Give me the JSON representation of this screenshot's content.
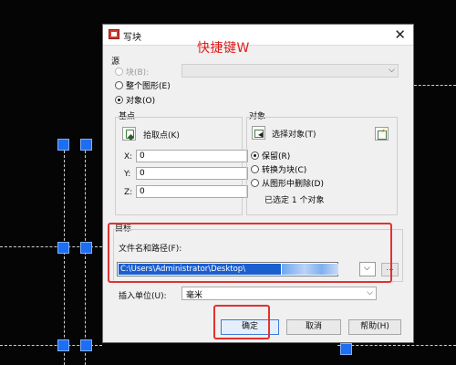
{
  "dialog": {
    "title": "写块",
    "close_glyph": "✕",
    "hotkey_note": "快捷键W"
  },
  "source": {
    "title": "源",
    "block_label": "块(B):",
    "block_value": "",
    "entire_drawing_label": "整个图形(E)",
    "objects_label": "对象(O)",
    "selected": "objects"
  },
  "base_point": {
    "title": "基点",
    "pick_label": "拾取点(K)",
    "x_label": "X:",
    "y_label": "Y:",
    "z_label": "Z:",
    "x": "0",
    "y": "0",
    "z": "0"
  },
  "objects": {
    "title": "对象",
    "select_label": "选择对象(T)",
    "retain_label": "保留(R)",
    "convert_label": "转换为块(C)",
    "delete_label": "从图形中删除(D)",
    "selected_mode": "retain",
    "status": "已选定 1 个对象"
  },
  "destination": {
    "title": "目标",
    "path_label": "文件名和路径(F):",
    "path_value": "C:\\Users\\Administrator\\Desktop\\",
    "browse_label": "...",
    "units_label": "插入单位(U):",
    "units_value": "毫米"
  },
  "buttons": {
    "ok": "确定",
    "cancel": "取消",
    "help": "帮助(H)"
  },
  "icons": {
    "dropdown": "⌵"
  },
  "colors": {
    "highlight_red": "#e23131",
    "grip_blue": "#1f6df0",
    "selection_blue": "#1a5fd0"
  }
}
